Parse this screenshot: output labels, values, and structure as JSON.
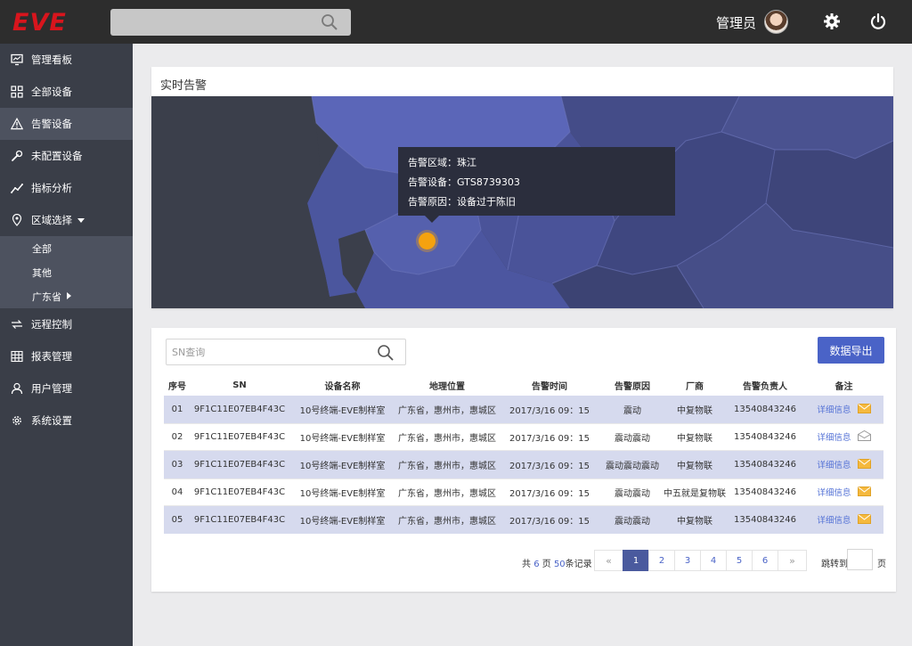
{
  "header": {
    "logo": "EVE",
    "user_name": "管理员"
  },
  "sidebar": {
    "items": [
      {
        "label": "管理看板",
        "icon": "monitor-icon"
      },
      {
        "label": "全部设备",
        "icon": "grid-icon"
      },
      {
        "label": "告警设备",
        "icon": "warning-icon"
      },
      {
        "label": "未配置设备",
        "icon": "wrench-icon"
      },
      {
        "label": "指标分析",
        "icon": "trend-icon"
      },
      {
        "label": "区域选择",
        "icon": "location-icon"
      },
      {
        "label": "远程控制",
        "icon": "remote-icon"
      },
      {
        "label": "报表管理",
        "icon": "table-icon"
      },
      {
        "label": "用户管理",
        "icon": "user-icon"
      },
      {
        "label": "系统设置",
        "icon": "gear-icon"
      }
    ],
    "sub_items": [
      "全部",
      "其他",
      "广东省"
    ]
  },
  "alert_panel": {
    "title": "实时告警",
    "tooltip": {
      "region": "告警区域：珠江",
      "device": "告警设备：GTS8739303",
      "reason": "告警原因：设备过于陈旧"
    }
  },
  "table_panel": {
    "search_placeholder": "SN查询",
    "export_label": "数据导出",
    "columns": [
      "序号",
      "SN",
      "设备名称",
      "地理位置",
      "告警时间",
      "告警原因",
      "厂商",
      "告警负责人",
      "备注"
    ],
    "rows": [
      {
        "no": "01",
        "sn": "9F1C11E07EB4F43C",
        "name": "10号终端-EVE制样室",
        "location": "广东省，惠州市，惠城区",
        "time": "2017/3/16 09：15",
        "reason": "震动",
        "vendor": "中复物联",
        "owner": "13540843246",
        "note": "详细信息"
      },
      {
        "no": "02",
        "sn": "9F1C11E07EB4F43C",
        "name": "10号终端-EVE制样室",
        "location": "广东省，惠州市，惠城区",
        "time": "2017/3/16 09：15",
        "reason": "震动震动",
        "vendor": "中复物联",
        "owner": "13540843246",
        "note": "详细信息"
      },
      {
        "no": "03",
        "sn": "9F1C11E07EB4F43C",
        "name": "10号终端-EVE制样室",
        "location": "广东省，惠州市，惠城区",
        "time": "2017/3/16 09：15",
        "reason": "震动震动震动",
        "vendor": "中复物联",
        "owner": "13540843246",
        "note": "详细信息"
      },
      {
        "no": "04",
        "sn": "9F1C11E07EB4F43C",
        "name": "10号终端-EVE制样室",
        "location": "广东省，惠州市，惠城区",
        "time": "2017/3/16 09：15",
        "reason": "震动震动",
        "vendor": "中五就是复物联",
        "owner": "13540843246",
        "note": "详细信息"
      },
      {
        "no": "05",
        "sn": "9F1C11E07EB4F43C",
        "name": "10号终端-EVE制样室",
        "location": "广东省，惠州市，惠城区",
        "time": "2017/3/16 09：15",
        "reason": "震动震动",
        "vendor": "中复物联",
        "owner": "13540843246",
        "note": "详细信息"
      }
    ],
    "pagination": {
      "total_prefix": "共",
      "total_pages": "6",
      "pages_unit": "页",
      "total_records": "50",
      "records_unit": "条记录",
      "prev": "«",
      "next": "»",
      "pages": [
        "1",
        "2",
        "3",
        "4",
        "5",
        "6"
      ],
      "current": "1",
      "jump_label": "跳转到",
      "jump_unit": "页"
    }
  },
  "colors": {
    "brand_red": "#d8151d",
    "accent_blue": "#4a63c7",
    "row_highlight": "#d6daee",
    "sidebar_bg": "#3a3e48",
    "alert_pin": "#f5a20f"
  }
}
